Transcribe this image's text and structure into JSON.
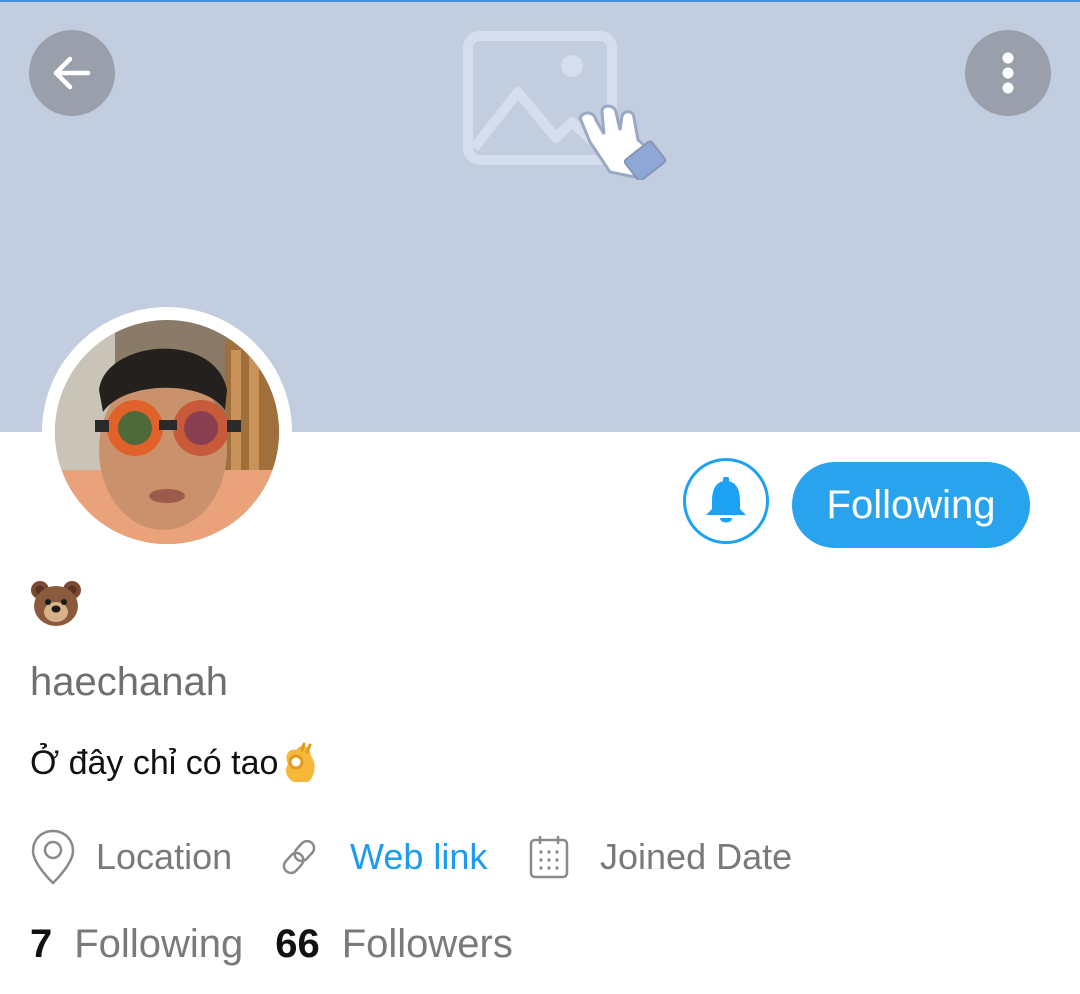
{
  "header": {
    "banner_color": "#c2cde0",
    "back_icon": "arrow-left-icon",
    "more_icon": "more-vertical-icon",
    "banner_placeholder_icon": "image-placeholder-with-tap-hand-icon"
  },
  "profile": {
    "display_name_emoji": "🐻",
    "handle": "haechanah",
    "bio": "Ở đây chỉ có tao",
    "bio_emoji": "👌"
  },
  "actions": {
    "notify_icon": "bell-icon",
    "follow_label": "Following",
    "accent_color": "#1da1f2"
  },
  "meta": {
    "location": "Location",
    "web_link": "Web link",
    "joined": "Joined Date"
  },
  "stats": {
    "following_count": "7",
    "following_label": "Following",
    "followers_count": "66",
    "followers_label": "Followers"
  }
}
